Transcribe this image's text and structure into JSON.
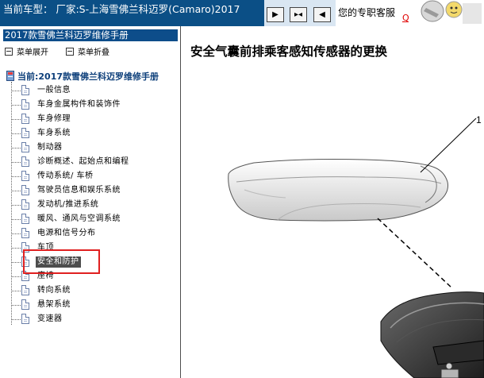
{
  "header": {
    "car_info": "当前车型： 厂家:S-上海雪佛兰科迈罗(Camaro)2017",
    "nav_buttons": [
      {
        "icon": "play-right-icon",
        "glyph": "▶"
      },
      {
        "icon": "expand-arrows-icon",
        "glyph": "▸◂"
      },
      {
        "icon": "play-left-icon",
        "glyph": "◀"
      }
    ],
    "support_label": "您的专职客服",
    "support_link": "Q"
  },
  "sidebar": {
    "manual_title": "2017款雪佛兰科迈罗维修手册",
    "expand_label": "菜单展开",
    "collapse_label": "菜单折叠",
    "root_label": "当前:2017款雪佛兰科迈罗维修手册",
    "items": [
      {
        "label": "一般信息"
      },
      {
        "label": "车身金属构件和装饰件"
      },
      {
        "label": "车身修理"
      },
      {
        "label": "车身系统"
      },
      {
        "label": "制动器"
      },
      {
        "label": "诊断概述、起始点和编程"
      },
      {
        "label": "传动系统/ 车桥"
      },
      {
        "label": "驾驶员信息和娱乐系统"
      },
      {
        "label": "发动机/推进系统"
      },
      {
        "label": "暖风、通风与空调系统"
      },
      {
        "label": "电源和信号分布"
      },
      {
        "label": "车顶"
      },
      {
        "label": "安全和防护",
        "selected": true
      },
      {
        "label": "座椅"
      },
      {
        "label": "转向系统"
      },
      {
        "label": "悬架系统"
      },
      {
        "label": "变速器"
      }
    ]
  },
  "content": {
    "title": "安全气囊前排乘客感知传感器的更换",
    "callout_number": "1"
  },
  "colors": {
    "header_bg": "#0b4f86",
    "title_bar_bg": "#0d4d8a",
    "selected_bg": "#4d4d4d",
    "highlight_border": "#e02020",
    "support_link": "#e00000"
  }
}
